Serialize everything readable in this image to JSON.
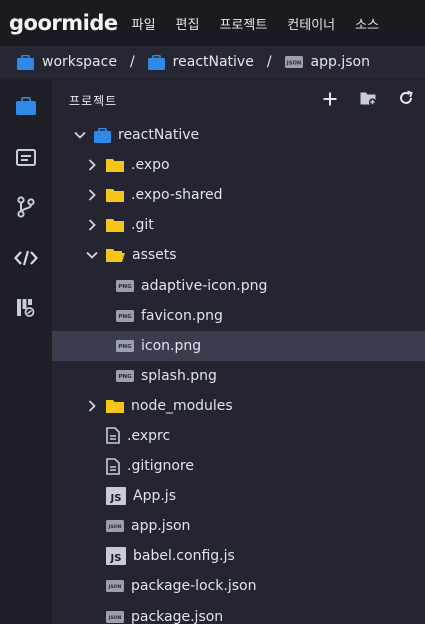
{
  "menubar": {
    "logo": "goormide",
    "items": [
      "파일",
      "편집",
      "프로젝트",
      "컨테이너",
      "소스"
    ]
  },
  "breadcrumb": {
    "items": [
      {
        "label": "workspace",
        "icon": "project-folder-icon"
      },
      {
        "label": "reactNative",
        "icon": "project-folder-icon"
      },
      {
        "label": "app.json",
        "icon": "json-file-icon"
      }
    ],
    "separator": "/"
  },
  "activity_bar": {
    "items": [
      {
        "name": "project-explorer",
        "icon": "briefcase-icon",
        "active": true
      },
      {
        "name": "outline",
        "icon": "list-panel-icon",
        "active": false
      },
      {
        "name": "source-control",
        "icon": "git-branch-icon",
        "active": false
      },
      {
        "name": "code",
        "icon": "code-brackets-icon",
        "active": false
      },
      {
        "name": "extensions",
        "icon": "blocks-icon",
        "active": false
      }
    ]
  },
  "explorer": {
    "title": "프로젝트",
    "actions": [
      "plus-icon",
      "new-folder-icon",
      "refresh-icon"
    ]
  },
  "tree": {
    "items": [
      {
        "label": "reactNative",
        "type": "project",
        "depth": 0,
        "expanded": true
      },
      {
        "label": ".expo",
        "type": "folder",
        "depth": 1,
        "expanded": false
      },
      {
        "label": ".expo-shared",
        "type": "folder",
        "depth": 1,
        "expanded": false
      },
      {
        "label": ".git",
        "type": "folder",
        "depth": 1,
        "expanded": false
      },
      {
        "label": "assets",
        "type": "folder",
        "depth": 1,
        "expanded": true
      },
      {
        "label": "adaptive-icon.png",
        "type": "png",
        "depth": 2
      },
      {
        "label": "favicon.png",
        "type": "png",
        "depth": 2
      },
      {
        "label": "icon.png",
        "type": "png",
        "depth": 2,
        "selected": true
      },
      {
        "label": "splash.png",
        "type": "png",
        "depth": 2
      },
      {
        "label": "node_modules",
        "type": "folder",
        "depth": 1,
        "expanded": false
      },
      {
        "label": ".exprc",
        "type": "text",
        "depth": 1
      },
      {
        "label": ".gitignore",
        "type": "text",
        "depth": 1
      },
      {
        "label": "App.js",
        "type": "js",
        "depth": 1
      },
      {
        "label": "app.json",
        "type": "json",
        "depth": 1
      },
      {
        "label": "babel.config.js",
        "type": "js",
        "depth": 1
      },
      {
        "label": "package-lock.json",
        "type": "json",
        "depth": 1
      },
      {
        "label": "package.json",
        "type": "json",
        "depth": 1
      }
    ]
  },
  "icon_text": {
    "png": "PNG",
    "json": "JSON",
    "js": "JS"
  },
  "colors": {
    "accent_blue": "#2e8ae6",
    "folder_yellow": "#f5c518",
    "selected_row": "#3a3d4e",
    "menubar_bg": "#1a1b20",
    "explorer_bg": "#242530"
  }
}
